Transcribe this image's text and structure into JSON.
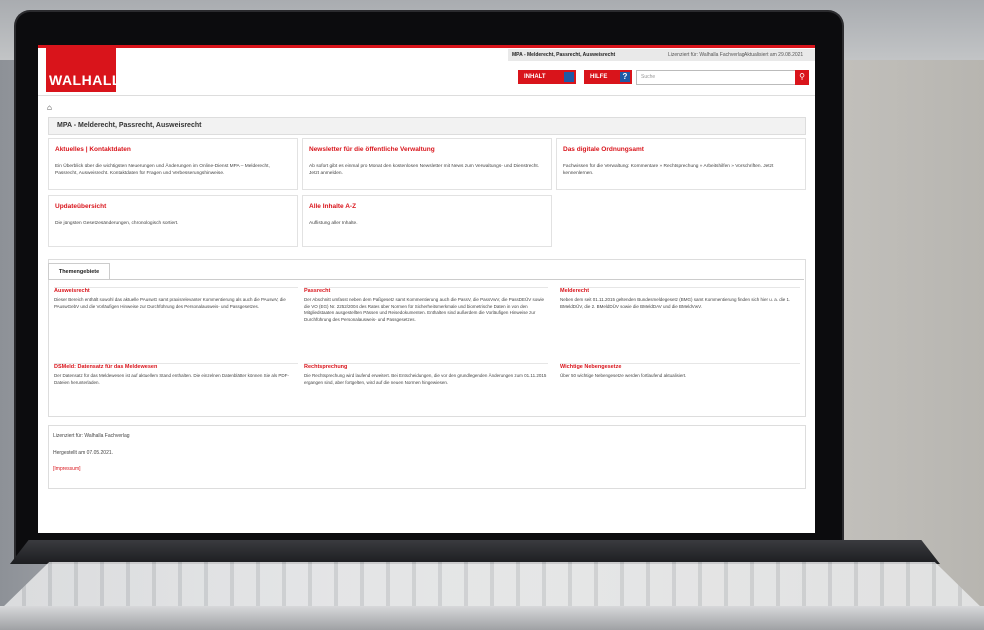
{
  "header": {
    "logo": "WALHALLA",
    "product_title": "MPA - Melderecht, Passrecht, Ausweisrecht",
    "licensed": "Lizenziert für: Walhalla Fachverlag",
    "updated": "Aktualisiert am 29.08.2021",
    "inhalt_label": "INHALT",
    "hilfe_label": "HILFE",
    "search_placeholder": "Suche"
  },
  "page_title": "MPA - Melderecht, Passrecht, Ausweisrecht",
  "cards": [
    {
      "title": "Aktuelles | Kontaktdaten",
      "text": "Ein Überblick über die wichtigsten Neuerungen und Änderungen im Online-Dienst MPA – Melderecht, Passrecht, Ausweisrecht. Kontaktdaten für Fragen und Verbesserungshinweise."
    },
    {
      "title": "Newsletter für die öffentliche Verwaltung",
      "text": "Ab sofort gibt es einmal pro Monat den kostenlosen Newsletter mit News zum Verwaltungs- und Dienstrecht. Jetzt anmelden."
    },
    {
      "title": "Das digitale Ordnungsamt",
      "text": "Fachwissen für die Verwaltung: Kommentare » Rechtsprechung » Arbeitshilfen » Vorschriften. Jetzt kennenlernen."
    },
    {
      "title": "Updateübersicht",
      "text": "Die jüngsten Gesetzesänderungen, chronologisch sortiert."
    },
    {
      "title": "Alle Inhalte A-Z",
      "text": "Auflistung aller Inhalte."
    }
  ],
  "tab_label": "Themengebiete",
  "themes": [
    {
      "title": "Ausweisrecht",
      "text": "Dieser Bereich enthält sowohl das aktuelle PAuswG samt praxisrelevanter Kommentierung als auch die PAuswV, die PAuswGebV und die Vorläufigen Hinweise zur Durchführung des Personalausweis- und Passgesetzes."
    },
    {
      "title": "Passrecht",
      "text": "Der Abschnitt umfasst neben dem Paßgesetz samt Kommentierung auch die PassV, die PassVwV, die PassDEÜV sowie die VO (EG) Nr. 2252/2004 des Rates über Normen für Sicherheitsmerkmale und biometrische Daten in von den Mitgliedstaaten ausgestellten Pässen und Reisedokumenten. Enthalten sind außerdem die Vorläufigen Hinweise zur Durchführung des Personalausweis- und Passgesetzes."
    },
    {
      "title": "Melderecht",
      "text": "Neben dem seit 01.11.2015 geltenden Bundesmeldegesetz (BMG) samt Kommentierung finden sich hier u. a. die 1. BMeldDÜV, die 2. BMeldDÜV sowie die BMeldDAV und die BMeldVwV."
    },
    {
      "title": "DSMeld: Datensatz für das Meldewesen",
      "text": "Der Datensatz für das Meldewesen ist auf aktuellem Stand enthalten. Die einzelnen Datenblätter können Sie als PDF-Dateien herunterladen."
    },
    {
      "title": "Rechtsprechung",
      "text": "Die Rechtsprechung wird laufend erweitert. Bei Entscheidungen, die vor den grundlegenden Änderungen zum 01.11.2015 ergangen sind, aber fortgelten, wird auf die neuen Normen hingewiesen."
    },
    {
      "title": "Wichtige Nebengesetze",
      "text": "Über 50 wichtige Nebengesetze werden fortlaufend aktualisiert."
    }
  ],
  "footer": {
    "licensed": "Lizenziert für: Walhalla Fachverlag",
    "created": "Hergestellt am 07.05.2021.",
    "impressum": "[Impressum]"
  }
}
